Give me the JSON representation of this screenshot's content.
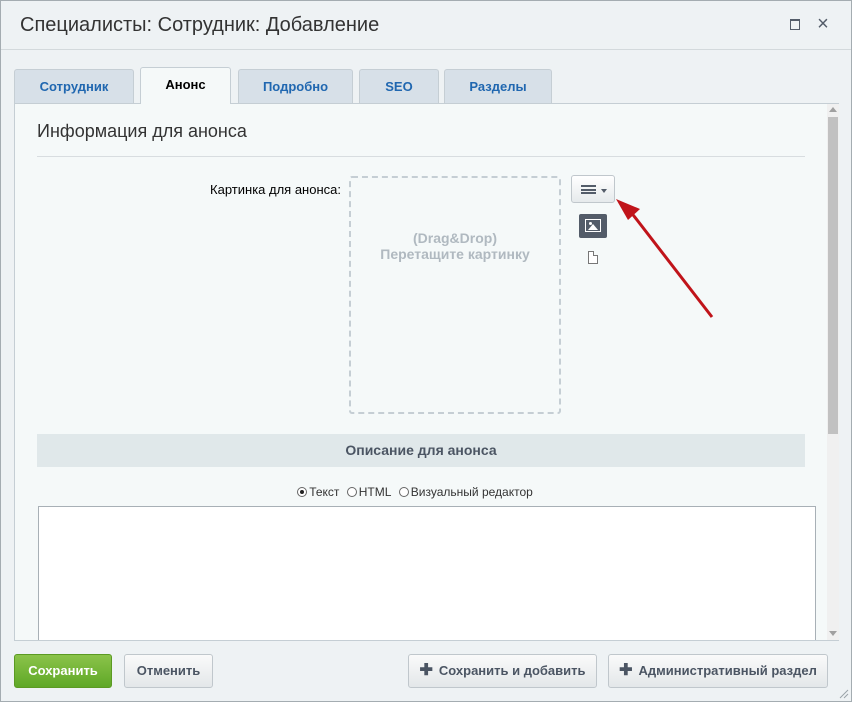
{
  "window": {
    "title": "Специалисты: Сотрудник: Добавление"
  },
  "tabs": [
    {
      "label": "Сотрудник"
    },
    {
      "label": "Анонс"
    },
    {
      "label": "Подробно"
    },
    {
      "label": "SEO"
    },
    {
      "label": "Разделы"
    }
  ],
  "active_tab": "Анонс",
  "content": {
    "section_title": "Информация для анонса",
    "image_label": "Картинка для анонса:",
    "dropzone_line1": "(Drag&Drop)",
    "dropzone_line2": "Перетащите картинку",
    "description_header": "Описание для анонса",
    "radio_options": [
      {
        "label": "Текст",
        "checked": true
      },
      {
        "label": "HTML",
        "checked": false
      },
      {
        "label": "Визуальный редактор",
        "checked": false
      }
    ],
    "textarea_value": ""
  },
  "footer": {
    "save_label": "Сохранить",
    "cancel_label": "Отменить",
    "save_add_label": "Сохранить и добавить",
    "admin_label": "Административный раздел"
  },
  "colors": {
    "accent": "#2067b0",
    "save_green": "#6cb52d",
    "annotation_arrow": "#c0141a"
  },
  "icons": [
    "menu-icon",
    "image-icon",
    "file-icon",
    "maximize-icon",
    "close-icon",
    "plus-icon"
  ]
}
